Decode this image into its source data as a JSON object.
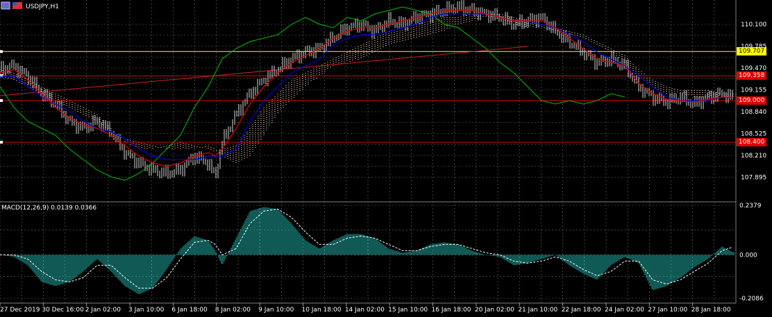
{
  "symbol_label": "USDJPY,H1",
  "chart_data": [
    {
      "type": "line",
      "title": "USDJPY,H1",
      "ylim": [
        107.55,
        110.45
      ],
      "y_ticks": [
        "110.100",
        "109.785",
        "109.470",
        "109.155",
        "108.840",
        "108.525",
        "108.210",
        "107.895"
      ],
      "x_tick_labels": [
        "27 Dec 2019",
        "30 Dec 16:00",
        "2 Jan 02:00",
        "3 Jan 10:00",
        "6 Jan 18:00",
        "8 Jan 02:00",
        "9 Jan 10:00",
        "10 Jan 18:00",
        "14 Jan 02:00",
        "15 Jan 10:00",
        "16 Jan 18:00",
        "20 Jan 02:00",
        "21 Jan 10:00",
        "22 Jan 18:00",
        "24 Jan 02:00",
        "27 Jan 10:00",
        "28 Jan 18:00"
      ],
      "grid": true,
      "price_levels": [
        {
          "label": "109.707",
          "color": "#ffff00",
          "bg": "#ffff00",
          "text_color": "#000000"
        },
        {
          "label": "109.358",
          "color": "#e00000",
          "bg": "#e00000",
          "text_color": "#ffffff"
        },
        {
          "label": "109.000",
          "color": "#e00000",
          "bg": "#e00000",
          "text_color": "#ffffff"
        },
        {
          "label": "108.400",
          "color": "#e00000",
          "bg": "#e00000",
          "text_color": "#ffffff"
        }
      ],
      "price_x": [
        0,
        20,
        40,
        60,
        80,
        100,
        120,
        140,
        160,
        180,
        200,
        220,
        240,
        260,
        280,
        300,
        310,
        320,
        340,
        360,
        380,
        400,
        420,
        440,
        460,
        480,
        500,
        520,
        540,
        560,
        580,
        600,
        620,
        640,
        660,
        680,
        700,
        720,
        740,
        760,
        780,
        800,
        820,
        840,
        860,
        880,
        900,
        920,
        940,
        960,
        980,
        1000,
        1020,
        1040,
        1055
      ],
      "price_close": [
        109.45,
        109.5,
        109.35,
        109.1,
        108.95,
        108.7,
        108.6,
        108.7,
        108.55,
        108.25,
        108.1,
        108.0,
        107.95,
        108.0,
        108.2,
        108.1,
        107.9,
        108.4,
        108.8,
        109.1,
        109.3,
        109.45,
        109.6,
        109.7,
        109.75,
        109.9,
        110.05,
        110.1,
        110.0,
        110.15,
        110.1,
        110.2,
        110.25,
        110.3,
        110.35,
        110.3,
        110.25,
        110.2,
        110.1,
        110.15,
        110.2,
        110.0,
        109.85,
        109.7,
        109.55,
        109.6,
        109.5,
        109.2,
        109.05,
        108.98,
        109.05,
        108.95,
        109.05,
        109.1,
        109.05
      ],
      "tenkan": [
        109.4,
        109.45,
        109.3,
        109.1,
        108.9,
        108.75,
        108.65,
        108.6,
        108.5,
        108.35,
        108.2,
        108.1,
        108.05,
        108.1,
        108.2,
        108.25,
        108.2,
        108.3,
        108.6,
        108.95,
        109.2,
        109.4,
        109.55,
        109.65,
        109.75,
        109.9,
        110.0,
        110.05,
        110.05,
        110.1,
        110.15,
        110.2,
        110.25,
        110.3,
        110.3,
        110.3,
        110.25,
        110.2,
        110.15,
        110.15,
        110.15,
        110.05,
        109.9,
        109.75,
        109.6,
        109.55,
        109.5,
        109.25,
        109.1,
        109.02,
        109.0,
        108.98,
        109.02,
        109.05,
        109.05
      ],
      "kijun": [
        109.35,
        109.35,
        109.2,
        109.05,
        108.95,
        108.85,
        108.7,
        108.6,
        108.55,
        108.45,
        108.3,
        108.2,
        108.15,
        108.15,
        108.15,
        108.2,
        108.2,
        108.2,
        108.3,
        108.7,
        109.0,
        109.2,
        109.4,
        109.5,
        109.6,
        109.8,
        109.9,
        109.95,
        109.95,
        110.0,
        110.05,
        110.1,
        110.2,
        110.25,
        110.25,
        110.25,
        110.25,
        110.2,
        110.15,
        110.15,
        110.1,
        110.05,
        109.95,
        109.85,
        109.7,
        109.6,
        109.5,
        109.35,
        109.2,
        109.05,
        109.0,
        109.0,
        109.0,
        109.05,
        109.05
      ],
      "chikou": [
        109.2,
        108.9,
        108.7,
        108.6,
        108.5,
        108.3,
        108.15,
        108.0,
        107.9,
        107.85,
        107.95,
        108.1,
        108.3,
        108.5,
        108.9,
        109.2,
        109.4,
        109.6,
        109.75,
        109.85,
        109.9,
        109.95,
        110.1,
        110.2,
        110.1,
        110.05,
        110.2,
        110.15,
        110.25,
        110.3,
        110.35,
        110.3,
        110.25,
        110.1,
        110.05,
        109.9,
        109.75,
        109.55,
        109.4,
        109.2,
        109.0,
        108.95,
        109.0,
        108.95,
        109.0,
        109.1,
        109.05
      ],
      "cloud_a": [
        109.45,
        109.4,
        109.3,
        109.2,
        109.1,
        109.0,
        108.9,
        108.8,
        108.6,
        108.4,
        108.3,
        108.3,
        108.35,
        108.4,
        108.35,
        108.3,
        108.25,
        108.3,
        108.35,
        108.6,
        108.9,
        109.1,
        109.3,
        109.4,
        109.5,
        109.6,
        109.7,
        109.8,
        109.9,
        110.0,
        110.05,
        110.1,
        110.15,
        110.2,
        110.2,
        110.25,
        110.25,
        110.25,
        110.2,
        110.15,
        110.1,
        110.05,
        110.0,
        109.95,
        109.85,
        109.75,
        109.65,
        109.45,
        109.3,
        109.2,
        109.15,
        109.15,
        109.15,
        109.1,
        109.1
      ],
      "cloud_b": [
        109.35,
        109.3,
        109.2,
        109.1,
        109.0,
        108.9,
        108.8,
        108.7,
        108.55,
        108.45,
        108.4,
        108.35,
        108.3,
        108.3,
        108.3,
        108.35,
        108.3,
        108.2,
        108.1,
        108.2,
        108.5,
        108.8,
        109.0,
        109.2,
        109.35,
        109.5,
        109.55,
        109.6,
        109.7,
        109.8,
        109.85,
        109.9,
        109.95,
        110.0,
        110.1,
        110.15,
        110.2,
        110.2,
        110.1,
        110.05,
        110.05,
        110.0,
        109.95,
        109.9,
        109.8,
        109.7,
        109.55,
        109.35,
        109.2,
        109.1,
        109.1,
        109.05,
        109.05,
        109.05,
        109.05
      ]
    },
    {
      "type": "bar",
      "title": "MACD(12,26,9) 0.0139 0.0366",
      "ylim": [
        -0.2086,
        0.2379
      ],
      "y_ticks": [
        "0.2379",
        "0.000",
        "-0.2086"
      ],
      "x": [
        0,
        20,
        40,
        60,
        80,
        100,
        120,
        140,
        160,
        180,
        200,
        220,
        240,
        260,
        280,
        300,
        310,
        320,
        340,
        360,
        380,
        400,
        420,
        440,
        460,
        480,
        500,
        520,
        540,
        560,
        580,
        600,
        620,
        640,
        660,
        680,
        700,
        720,
        740,
        760,
        780,
        800,
        820,
        840,
        860,
        880,
        900,
        920,
        940,
        960,
        980,
        1000,
        1020,
        1040,
        1055
      ],
      "macd": [
        0.0,
        -0.01,
        -0.05,
        -0.13,
        -0.15,
        -0.13,
        -0.08,
        -0.02,
        -0.08,
        -0.15,
        -0.19,
        -0.16,
        -0.07,
        0.03,
        0.09,
        0.07,
        0.02,
        -0.05,
        0.08,
        0.21,
        0.23,
        0.22,
        0.15,
        0.07,
        0.03,
        0.07,
        0.1,
        0.1,
        0.08,
        0.03,
        0.01,
        0.02,
        0.05,
        0.06,
        0.05,
        0.02,
        0.0,
        -0.01,
        -0.05,
        -0.04,
        -0.02,
        0.0,
        -0.05,
        -0.09,
        -0.12,
        -0.05,
        -0.01,
        -0.04,
        -0.17,
        -0.15,
        -0.11,
        -0.06,
        -0.02,
        0.04,
        0.0139
      ],
      "signal": [
        0.0,
        0.0,
        -0.02,
        -0.08,
        -0.12,
        -0.13,
        -0.11,
        -0.05,
        -0.05,
        -0.11,
        -0.16,
        -0.16,
        -0.11,
        -0.02,
        0.06,
        0.07,
        0.05,
        0.0,
        0.03,
        0.15,
        0.21,
        0.22,
        0.18,
        0.11,
        0.05,
        0.05,
        0.08,
        0.09,
        0.08,
        0.05,
        0.02,
        0.02,
        0.04,
        0.05,
        0.05,
        0.03,
        0.01,
        0.0,
        -0.03,
        -0.04,
        -0.03,
        -0.01,
        -0.03,
        -0.07,
        -0.1,
        -0.08,
        -0.03,
        -0.03,
        -0.12,
        -0.14,
        -0.12,
        -0.08,
        -0.04,
        0.02,
        0.0366
      ]
    }
  ]
}
